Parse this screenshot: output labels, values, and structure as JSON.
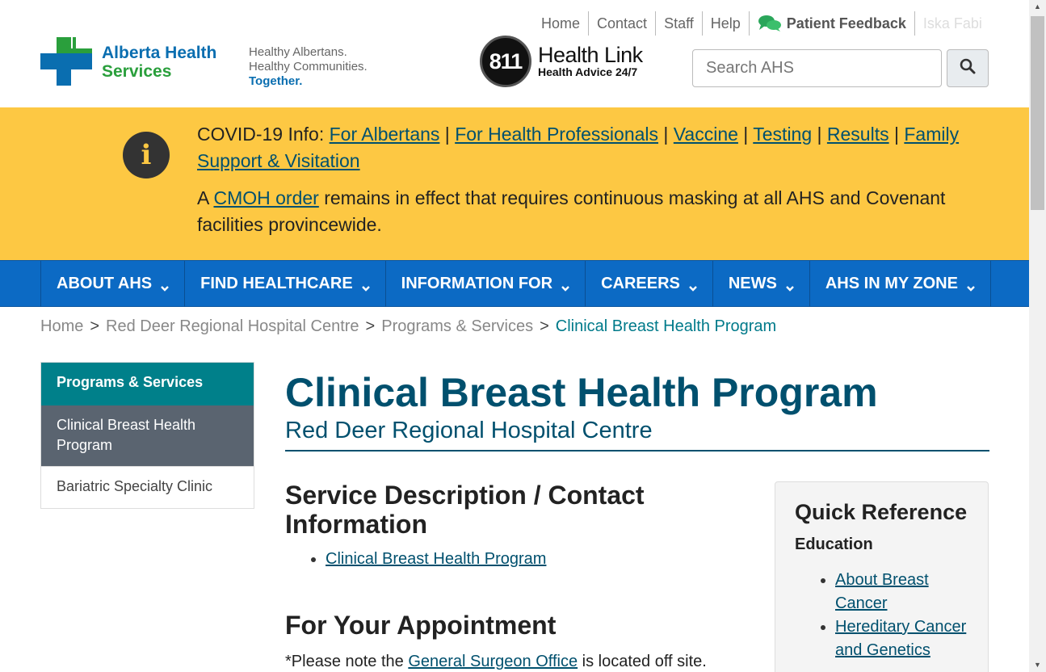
{
  "util_nav": {
    "home": "Home",
    "contact": "Contact",
    "staff": "Staff",
    "help": "Help",
    "feedback": "Patient Feedback",
    "other": "Iska Fabi"
  },
  "logo": {
    "line1": "Alberta Health",
    "line2": "Services"
  },
  "tagline": {
    "line1": "Healthy Albertans.",
    "line2": "Healthy Communities.",
    "line3": "Together."
  },
  "healthlink": {
    "number": "811",
    "title": "Health Link",
    "sub": "Health Advice 24/7"
  },
  "search": {
    "placeholder": "Search AHS"
  },
  "alert": {
    "prefix": "COVID-19 Info:",
    "links": [
      "For Albertans",
      "For Health Professionals",
      "Vaccine",
      "Testing",
      "Results",
      "Family Support & Visitation"
    ],
    "p2_before": "A",
    "p2_link": "CMOH order",
    "p2_after": "remains in effect that requires continuous masking at all AHS and Covenant facilities provincewide."
  },
  "main_nav": [
    "ABOUT AHS",
    "FIND HEALTHCARE",
    "INFORMATION FOR",
    "CAREERS",
    "NEWS",
    "AHS IN MY ZONE"
  ],
  "breadcrumb": [
    "Home",
    "Red Deer Regional Hospital Centre",
    "Programs & Services",
    "Clinical Breast Health Program"
  ],
  "sidenav": {
    "head": "Programs & Services",
    "active": "Clinical Breast Health Program",
    "items": [
      "Bariatric Specialty Clinic"
    ]
  },
  "page": {
    "title": "Clinical Breast Health Program",
    "subtitle": "Red Deer Regional Hospital Centre"
  },
  "section1": {
    "heading": "Service Description / Contact Information",
    "links": [
      "Clinical Breast Health Program"
    ]
  },
  "section2": {
    "heading": "For Your Appointment",
    "note_before": "*Please note the",
    "note_link": "General Surgeon Office",
    "note_after": "is located off site."
  },
  "quickref": {
    "title": "Quick Reference",
    "subhead": "Education",
    "links": [
      "About Breast Cancer",
      "Hereditary Cancer and Genetics"
    ]
  },
  "colors": {
    "alert_bg": "#fdc843",
    "nav_bg": "#0c6ac4",
    "sidenav_head": "#00808a",
    "sidenav_active": "#5a6470",
    "title": "#00506e"
  }
}
